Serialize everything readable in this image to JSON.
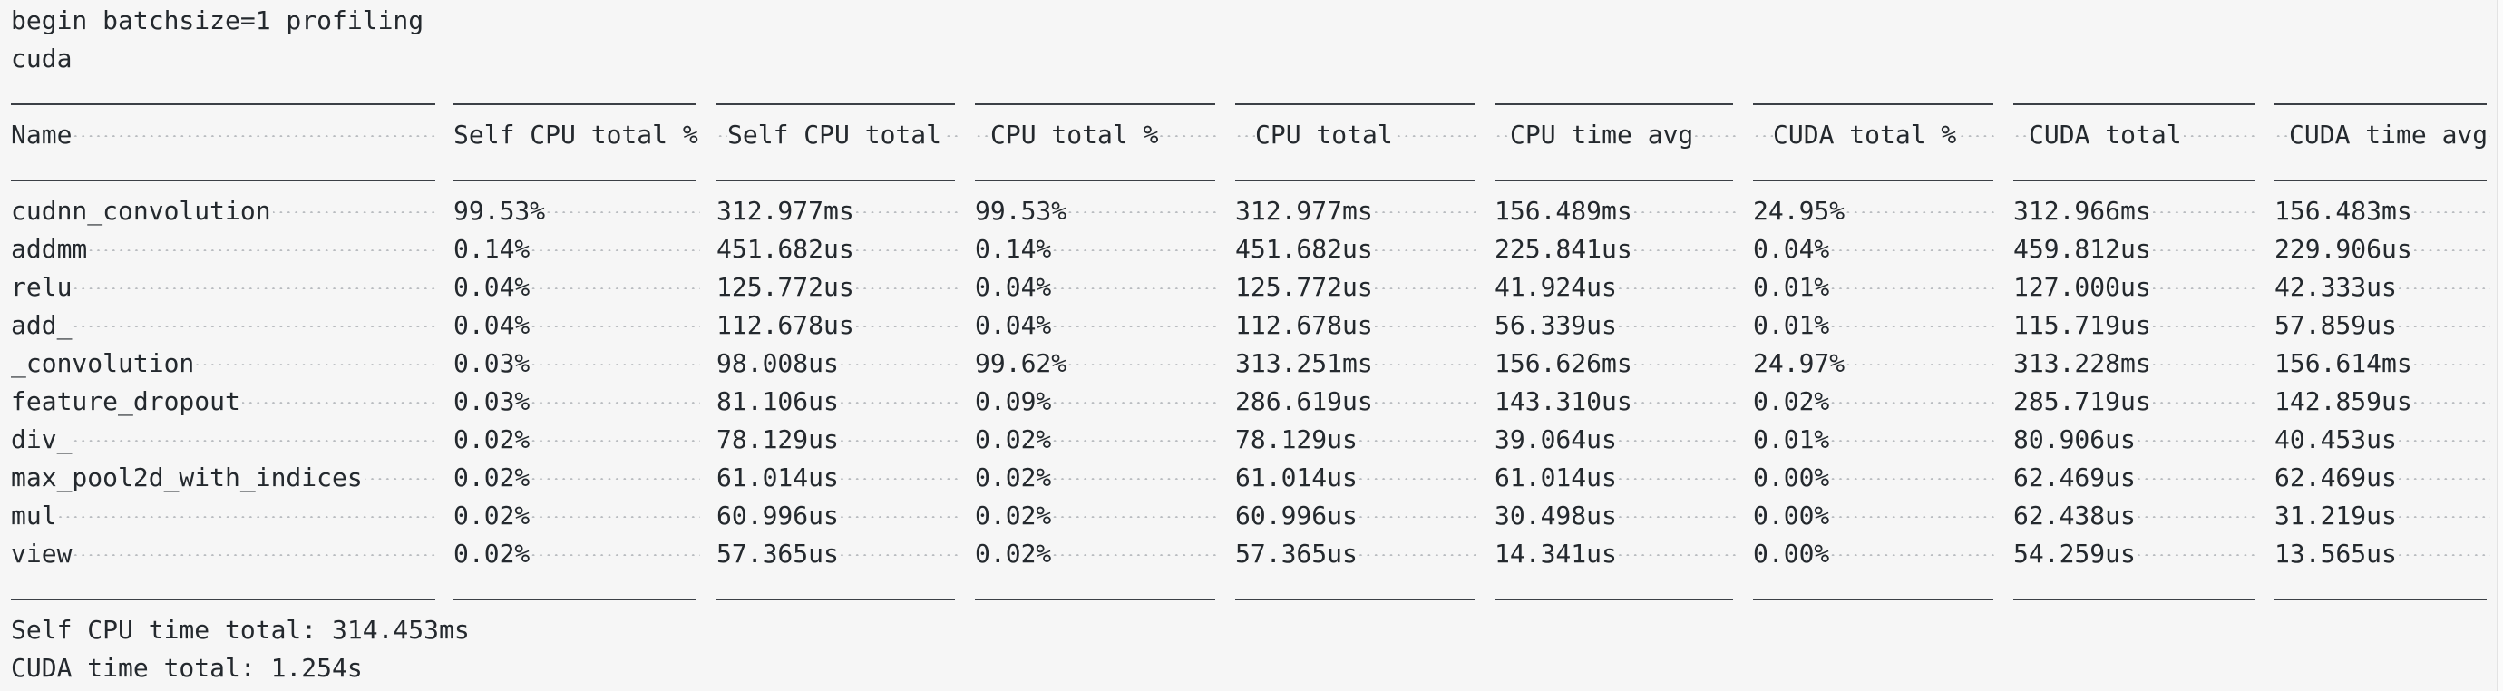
{
  "header_lines": [
    "begin batchsize=1 profiling",
    "cuda"
  ],
  "columns": [
    "Name",
    "Self CPU total %",
    "Self CPU total",
    "CPU total %",
    "CPU total",
    "CPU time avg",
    "CUDA total %",
    "CUDA total",
    "CUDA time avg"
  ],
  "rows": [
    [
      "cudnn_convolution",
      "99.53%",
      "312.977ms",
      "99.53%",
      "312.977ms",
      "156.489ms",
      "24.95%",
      "312.966ms",
      "156.483ms"
    ],
    [
      "addmm",
      "0.14%",
      "451.682us",
      "0.14%",
      "451.682us",
      "225.841us",
      "0.04%",
      "459.812us",
      "229.906us"
    ],
    [
      "relu",
      "0.04%",
      "125.772us",
      "0.04%",
      "125.772us",
      "41.924us",
      "0.01%",
      "127.000us",
      "42.333us"
    ],
    [
      "add_",
      "0.04%",
      "112.678us",
      "0.04%",
      "112.678us",
      "56.339us",
      "0.01%",
      "115.719us",
      "57.859us"
    ],
    [
      "_convolution",
      "0.03%",
      "98.008us",
      "99.62%",
      "313.251ms",
      "156.626ms",
      "24.97%",
      "313.228ms",
      "156.614ms"
    ],
    [
      "feature_dropout",
      "0.03%",
      "81.106us",
      "0.09%",
      "286.619us",
      "143.310us",
      "0.02%",
      "285.719us",
      "142.859us"
    ],
    [
      "div_",
      "0.02%",
      "78.129us",
      "0.02%",
      "78.129us",
      "39.064us",
      "0.01%",
      "80.906us",
      "40.453us"
    ],
    [
      "max_pool2d_with_indices",
      "0.02%",
      "61.014us",
      "0.02%",
      "61.014us",
      "61.014us",
      "0.00%",
      "62.469us",
      "62.469us"
    ],
    [
      "mul",
      "0.02%",
      "60.996us",
      "0.02%",
      "60.996us",
      "30.498us",
      "0.00%",
      "62.438us",
      "31.219us"
    ],
    [
      "view",
      "0.02%",
      "57.365us",
      "0.02%",
      "57.365us",
      "14.341us",
      "0.00%",
      "54.259us",
      "13.565us"
    ]
  ],
  "footer_lines": [
    "Self CPU time total: 314.453ms",
    "CUDA time total: 1.254s"
  ]
}
